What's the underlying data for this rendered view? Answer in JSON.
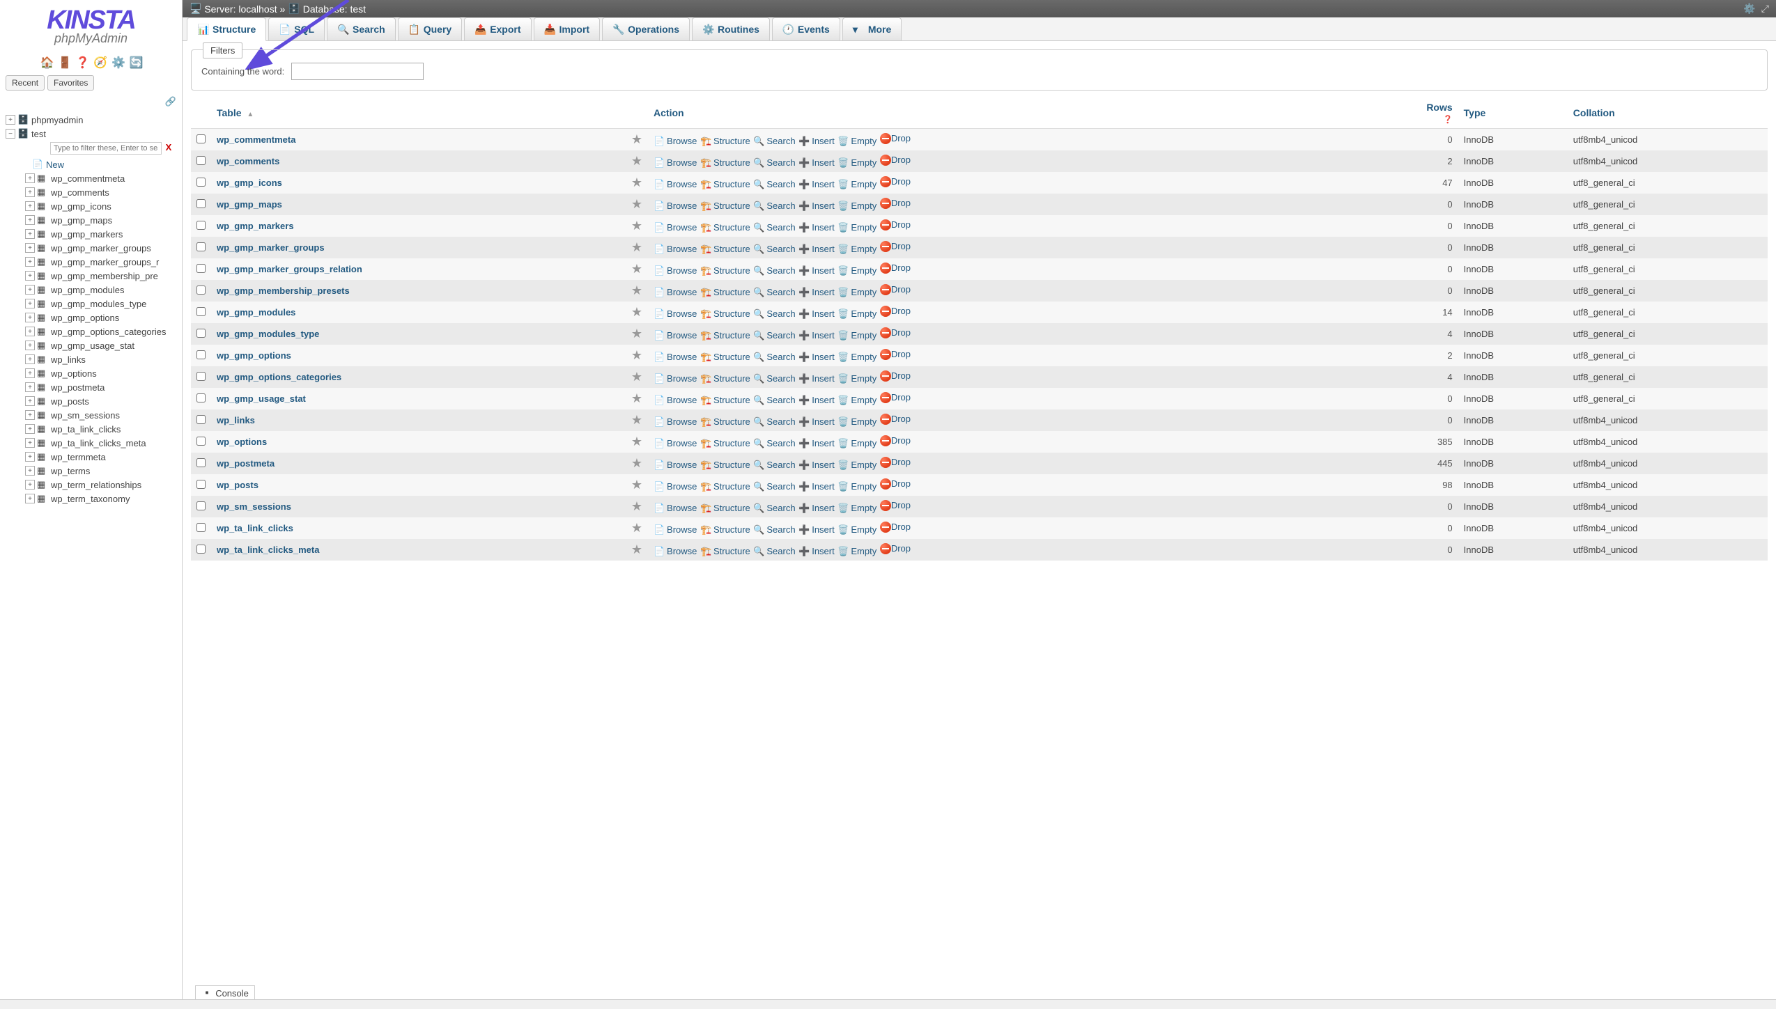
{
  "logo": {
    "main": "KINSTA",
    "sub": "phpMyAdmin"
  },
  "sidebar_btns": {
    "recent": "Recent",
    "favorites": "Favorites"
  },
  "tree_filter_placeholder": "Type to filter these, Enter to search",
  "tree": {
    "root": "phpmyadmin",
    "db": "test",
    "new": "New",
    "tables": [
      "wp_commentmeta",
      "wp_comments",
      "wp_gmp_icons",
      "wp_gmp_maps",
      "wp_gmp_markers",
      "wp_gmp_marker_groups",
      "wp_gmp_marker_groups_r",
      "wp_gmp_membership_pre",
      "wp_gmp_modules",
      "wp_gmp_modules_type",
      "wp_gmp_options",
      "wp_gmp_options_categories",
      "wp_gmp_usage_stat",
      "wp_links",
      "wp_options",
      "wp_postmeta",
      "wp_posts",
      "wp_sm_sessions",
      "wp_ta_link_clicks",
      "wp_ta_link_clicks_meta",
      "wp_termmeta",
      "wp_terms",
      "wp_term_relationships",
      "wp_term_taxonomy"
    ]
  },
  "breadcrumb": {
    "server_lbl": "Server:",
    "server": "localhost",
    "db_lbl": "Database:",
    "db": "test",
    "sep": "»"
  },
  "tabs": [
    {
      "label": "Structure",
      "icon": "structure"
    },
    {
      "label": "SQL",
      "icon": "sql"
    },
    {
      "label": "Search",
      "icon": "search"
    },
    {
      "label": "Query",
      "icon": "query"
    },
    {
      "label": "Export",
      "icon": "export"
    },
    {
      "label": "Import",
      "icon": "import"
    },
    {
      "label": "Operations",
      "icon": "operations"
    },
    {
      "label": "Routines",
      "icon": "routines"
    },
    {
      "label": "Events",
      "icon": "events"
    },
    {
      "label": "More",
      "icon": "more"
    }
  ],
  "filters": {
    "legend": "Filters",
    "label": "Containing the word:"
  },
  "columns": {
    "table": "Table",
    "action": "Action",
    "rows": "Rows",
    "type": "Type",
    "collation": "Collation"
  },
  "actions": {
    "browse": "Browse",
    "structure": "Structure",
    "search": "Search",
    "insert": "Insert",
    "empty": "Empty",
    "drop": "Drop"
  },
  "rows": [
    {
      "name": "wp_commentmeta",
      "rows": "0",
      "type": "InnoDB",
      "collation": "utf8mb4_unicod"
    },
    {
      "name": "wp_comments",
      "rows": "2",
      "type": "InnoDB",
      "collation": "utf8mb4_unicod"
    },
    {
      "name": "wp_gmp_icons",
      "rows": "47",
      "type": "InnoDB",
      "collation": "utf8_general_ci"
    },
    {
      "name": "wp_gmp_maps",
      "rows": "0",
      "type": "InnoDB",
      "collation": "utf8_general_ci"
    },
    {
      "name": "wp_gmp_markers",
      "rows": "0",
      "type": "InnoDB",
      "collation": "utf8_general_ci"
    },
    {
      "name": "wp_gmp_marker_groups",
      "rows": "0",
      "type": "InnoDB",
      "collation": "utf8_general_ci"
    },
    {
      "name": "wp_gmp_marker_groups_relation",
      "rows": "0",
      "type": "InnoDB",
      "collation": "utf8_general_ci"
    },
    {
      "name": "wp_gmp_membership_presets",
      "rows": "0",
      "type": "InnoDB",
      "collation": "utf8_general_ci"
    },
    {
      "name": "wp_gmp_modules",
      "rows": "14",
      "type": "InnoDB",
      "collation": "utf8_general_ci"
    },
    {
      "name": "wp_gmp_modules_type",
      "rows": "4",
      "type": "InnoDB",
      "collation": "utf8_general_ci"
    },
    {
      "name": "wp_gmp_options",
      "rows": "2",
      "type": "InnoDB",
      "collation": "utf8_general_ci"
    },
    {
      "name": "wp_gmp_options_categories",
      "rows": "4",
      "type": "InnoDB",
      "collation": "utf8_general_ci"
    },
    {
      "name": "wp_gmp_usage_stat",
      "rows": "0",
      "type": "InnoDB",
      "collation": "utf8_general_ci"
    },
    {
      "name": "wp_links",
      "rows": "0",
      "type": "InnoDB",
      "collation": "utf8mb4_unicod"
    },
    {
      "name": "wp_options",
      "rows": "385",
      "type": "InnoDB",
      "collation": "utf8mb4_unicod"
    },
    {
      "name": "wp_postmeta",
      "rows": "445",
      "type": "InnoDB",
      "collation": "utf8mb4_unicod"
    },
    {
      "name": "wp_posts",
      "rows": "98",
      "type": "InnoDB",
      "collation": "utf8mb4_unicod"
    },
    {
      "name": "wp_sm_sessions",
      "rows": "0",
      "type": "InnoDB",
      "collation": "utf8mb4_unicod"
    },
    {
      "name": "wp_ta_link_clicks",
      "rows": "0",
      "type": "InnoDB",
      "collation": "utf8mb4_unicod"
    },
    {
      "name": "wp_ta_link_clicks_meta",
      "rows": "0",
      "type": "InnoDB",
      "collation": "utf8mb4_unicod"
    }
  ],
  "console": "Console"
}
